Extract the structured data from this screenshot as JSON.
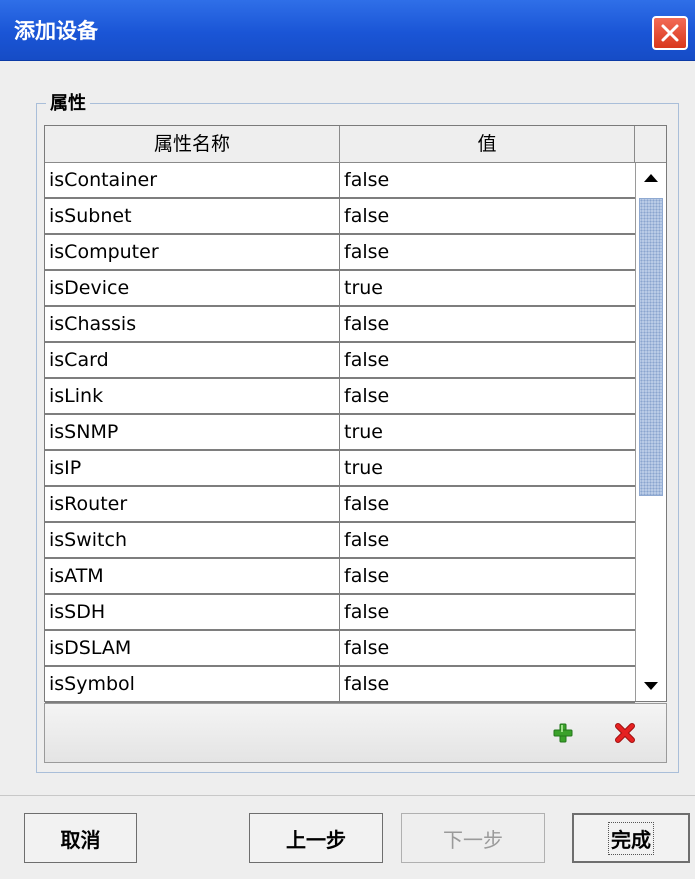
{
  "window": {
    "title": "添加设备"
  },
  "group": {
    "legend": "属性"
  },
  "table": {
    "columns": [
      "属性名称",
      "值"
    ],
    "rows": [
      {
        "name": "isContainer",
        "value": "false"
      },
      {
        "name": "isSubnet",
        "value": "false"
      },
      {
        "name": "isComputer",
        "value": "false"
      },
      {
        "name": "isDevice",
        "value": "true"
      },
      {
        "name": "isChassis",
        "value": "false"
      },
      {
        "name": "isCard",
        "value": "false"
      },
      {
        "name": "isLink",
        "value": "false"
      },
      {
        "name": "isSNMP",
        "value": "true"
      },
      {
        "name": "isIP",
        "value": "true"
      },
      {
        "name": "isRouter",
        "value": "false"
      },
      {
        "name": "isSwitch",
        "value": "false"
      },
      {
        "name": "isATM",
        "value": "false"
      },
      {
        "name": "isSDH",
        "value": "false"
      },
      {
        "name": "isDSLAM",
        "value": "false"
      },
      {
        "name": "isSymbol",
        "value": "false"
      }
    ]
  },
  "toolbar": {
    "add_icon": "plus-icon",
    "delete_icon": "delete-x-icon"
  },
  "buttons": {
    "cancel": "取消",
    "prev": "上一步",
    "next": "下一步",
    "finish": "完成"
  },
  "colors": {
    "title_bar": "#1a55d6",
    "close": "#d9371c",
    "add": "#3aa12a",
    "delete": "#d61a1a"
  }
}
